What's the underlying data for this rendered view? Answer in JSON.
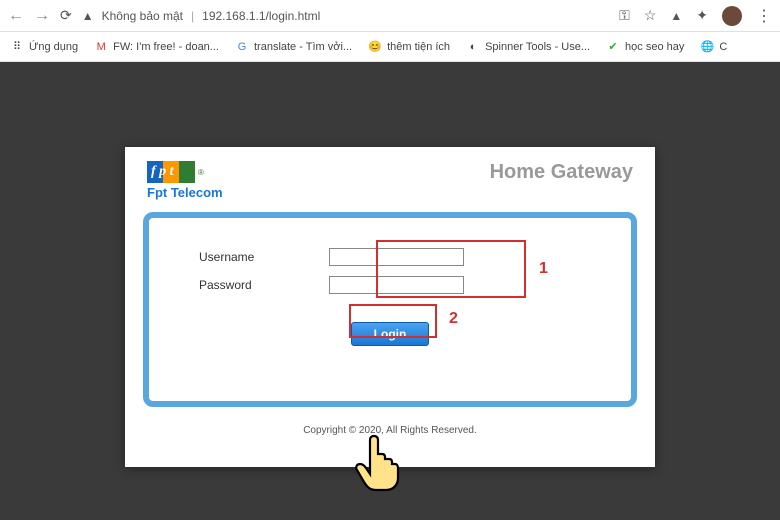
{
  "browser": {
    "security_text": "Không bảo mật",
    "url": "192.168.1.1/login.html"
  },
  "bookmarks": {
    "apps": "Ứng dụng",
    "gmail": "FW: I'm free! - doan...",
    "translate": "translate - Tìm vởi...",
    "addon": "thêm tiện ích",
    "spinner": "Spinner Tools - Use...",
    "seo": "học seo hay",
    "c": "C"
  },
  "modal": {
    "brand": "Fpt Telecom",
    "title": "Home Gateway",
    "username_label": "Username",
    "password_label": "Password",
    "username_value": "",
    "password_value": "",
    "login_button": "Login",
    "footer": "Copyright © 2020,           All Rights Reserved."
  },
  "annotations": {
    "one": "1",
    "two": "2"
  }
}
